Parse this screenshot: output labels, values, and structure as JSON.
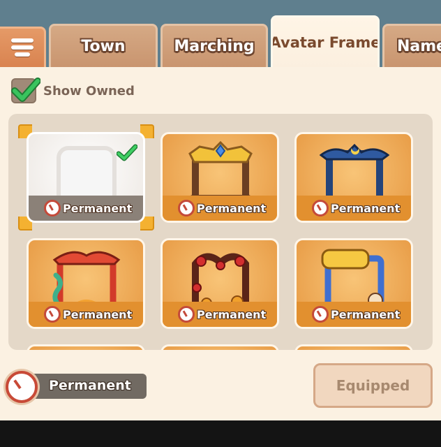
{
  "tabs": {
    "menu_icon": "list-menu-icon",
    "items": [
      {
        "label": "Town",
        "active": false
      },
      {
        "label": "Marching",
        "active": false
      },
      {
        "label": "Avatar Frame",
        "active": true
      },
      {
        "label": "Nameplate",
        "active": false
      }
    ]
  },
  "filter": {
    "label": "Show Owned",
    "checked": true
  },
  "frames": [
    {
      "duration": "Permanent",
      "owned": true,
      "selected": true,
      "style": "plain-white"
    },
    {
      "duration": "Permanent",
      "owned": false,
      "style": "gold-crown"
    },
    {
      "duration": "Permanent",
      "owned": false,
      "style": "blue-moon"
    },
    {
      "duration": "Permanent",
      "owned": false,
      "style": "red-dragon"
    },
    {
      "duration": "Permanent",
      "owned": false,
      "style": "rose-heart"
    },
    {
      "duration": "Permanent",
      "owned": false,
      "style": "2026-new-year"
    }
  ],
  "selected_info": {
    "duration": "Permanent"
  },
  "action_button": {
    "label": "Equipped",
    "enabled": false
  },
  "colors": {
    "accent": "#e79a44",
    "check": "#2fbf55",
    "clock": "#c44a3a"
  }
}
